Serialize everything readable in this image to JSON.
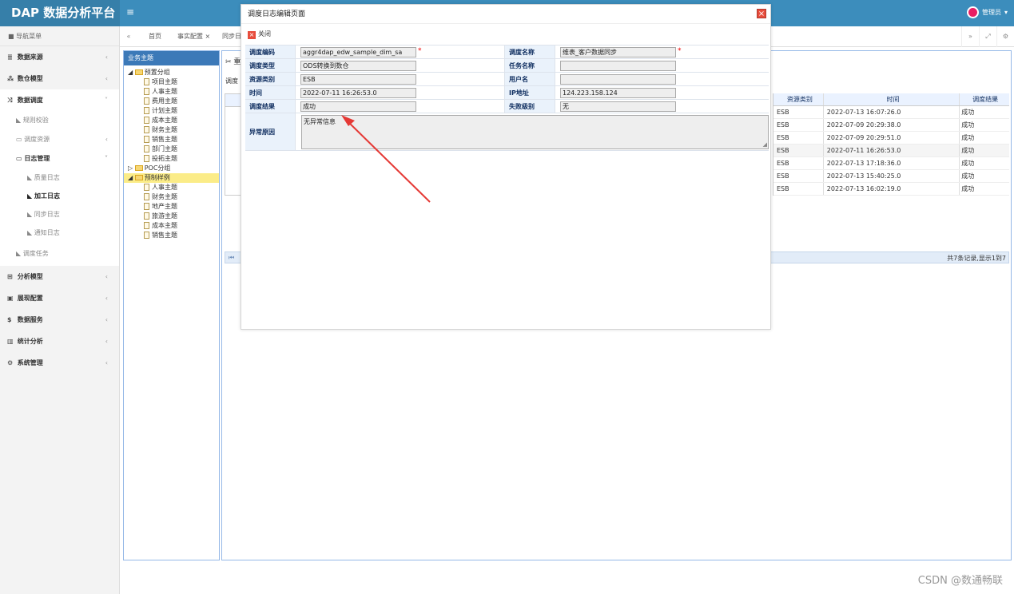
{
  "app": {
    "title": "DAP 数据分析平台",
    "user": "管理员"
  },
  "sidebar": {
    "header": "导航菜单",
    "items": [
      {
        "label": "数据来源"
      },
      {
        "label": "数仓模型"
      },
      {
        "label": "数据调度"
      },
      {
        "label": "规则校验"
      },
      {
        "label": "调度资源"
      },
      {
        "label": "日志管理"
      },
      {
        "label": "质量日志"
      },
      {
        "label": "加工日志"
      },
      {
        "label": "同步日志"
      },
      {
        "label": "通知日志"
      },
      {
        "label": "调度任务"
      },
      {
        "label": "分析模型"
      },
      {
        "label": "展现配置"
      },
      {
        "label": "数据服务"
      },
      {
        "label": "统计分析"
      },
      {
        "label": "系统管理"
      }
    ]
  },
  "tabs": {
    "home": "首页",
    "fact": "事实配置",
    "sync": "同步日"
  },
  "tree": {
    "header": "业务主题",
    "nodes": [
      "预置分组",
      "项目主题",
      "人事主题",
      "费用主题",
      "计划主题",
      "成本主题",
      "财务主题",
      "销售主题",
      "部门主题",
      "投拓主题",
      "POC分组",
      "预制样例",
      "人事主题",
      "财务主题",
      "地产主题",
      "旅游主题",
      "成本主题",
      "销售主题"
    ]
  },
  "main": {
    "toolbar_char": "重",
    "sub_char": "调度"
  },
  "grid": {
    "headers": [
      "资源类别",
      "时间",
      "调度结果"
    ],
    "rows": [
      [
        "ESB",
        "2022-07-13 16:07:26.0",
        "成功"
      ],
      [
        "ESB",
        "2022-07-09 20:29:38.0",
        "成功"
      ],
      [
        "ESB",
        "2022-07-09 20:29:51.0",
        "成功"
      ],
      [
        "ESB",
        "2022-07-11 16:26:53.0",
        "成功"
      ],
      [
        "ESB",
        "2022-07-13 17:18:36.0",
        "成功"
      ],
      [
        "ESB",
        "2022-07-13 15:40:25.0",
        "成功"
      ],
      [
        "ESB",
        "2022-07-13 16:02:19.0",
        "成功"
      ]
    ],
    "pager_info": "共7条记录,显示1到7"
  },
  "dialog": {
    "title": "调度日志编辑页面",
    "close_label": "关闭",
    "fields": {
      "code_label": "调度编码",
      "code_value": "aggr4dap_edw_sample_dim_sa",
      "name_label": "调度名称",
      "name_value": "维表_客户数据同步",
      "type_label": "调度类型",
      "type_value": "ODS转换到数仓",
      "task_label": "任务名称",
      "task_value": "",
      "resource_label": "资源类别",
      "resource_value": "ESB",
      "user_label": "用户名",
      "user_value": "",
      "time_label": "时间",
      "time_value": "2022-07-11 16:26:53.0",
      "ip_label": "IP地址",
      "ip_value": "124.223.158.124",
      "result_label": "调度结果",
      "result_value": "成功",
      "fail_label": "失败级别",
      "fail_value": "无",
      "error_label": "异常原因",
      "error_value": "无异常信息"
    }
  },
  "watermark": "CSDN @数通畅联",
  "colors": {
    "topbar": "#3c8dbc",
    "logo_bg": "#367fa9",
    "label_bg": "#eaf2fb",
    "arrow": "#e53935"
  }
}
